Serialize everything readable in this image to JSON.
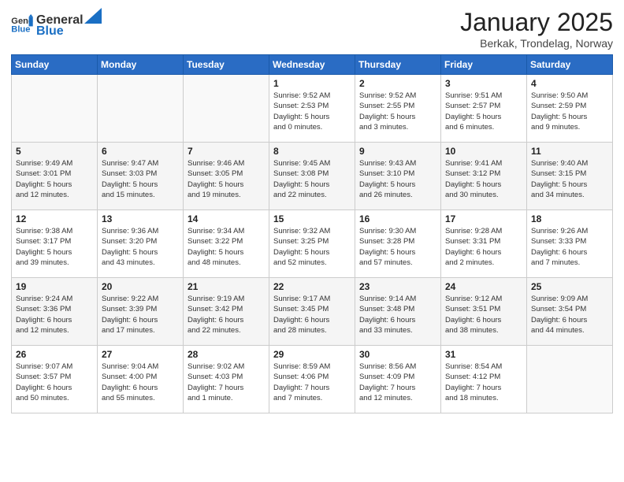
{
  "header": {
    "logo_general": "General",
    "logo_blue": "Blue",
    "title": "January 2025",
    "subtitle": "Berkak, Trondelag, Norway"
  },
  "weekdays": [
    "Sunday",
    "Monday",
    "Tuesday",
    "Wednesday",
    "Thursday",
    "Friday",
    "Saturday"
  ],
  "weeks": [
    [
      {
        "day": "",
        "info": ""
      },
      {
        "day": "",
        "info": ""
      },
      {
        "day": "",
        "info": ""
      },
      {
        "day": "1",
        "info": "Sunrise: 9:52 AM\nSunset: 2:53 PM\nDaylight: 5 hours\nand 0 minutes."
      },
      {
        "day": "2",
        "info": "Sunrise: 9:52 AM\nSunset: 2:55 PM\nDaylight: 5 hours\nand 3 minutes."
      },
      {
        "day": "3",
        "info": "Sunrise: 9:51 AM\nSunset: 2:57 PM\nDaylight: 5 hours\nand 6 minutes."
      },
      {
        "day": "4",
        "info": "Sunrise: 9:50 AM\nSunset: 2:59 PM\nDaylight: 5 hours\nand 9 minutes."
      }
    ],
    [
      {
        "day": "5",
        "info": "Sunrise: 9:49 AM\nSunset: 3:01 PM\nDaylight: 5 hours\nand 12 minutes."
      },
      {
        "day": "6",
        "info": "Sunrise: 9:47 AM\nSunset: 3:03 PM\nDaylight: 5 hours\nand 15 minutes."
      },
      {
        "day": "7",
        "info": "Sunrise: 9:46 AM\nSunset: 3:05 PM\nDaylight: 5 hours\nand 19 minutes."
      },
      {
        "day": "8",
        "info": "Sunrise: 9:45 AM\nSunset: 3:08 PM\nDaylight: 5 hours\nand 22 minutes."
      },
      {
        "day": "9",
        "info": "Sunrise: 9:43 AM\nSunset: 3:10 PM\nDaylight: 5 hours\nand 26 minutes."
      },
      {
        "day": "10",
        "info": "Sunrise: 9:41 AM\nSunset: 3:12 PM\nDaylight: 5 hours\nand 30 minutes."
      },
      {
        "day": "11",
        "info": "Sunrise: 9:40 AM\nSunset: 3:15 PM\nDaylight: 5 hours\nand 34 minutes."
      }
    ],
    [
      {
        "day": "12",
        "info": "Sunrise: 9:38 AM\nSunset: 3:17 PM\nDaylight: 5 hours\nand 39 minutes."
      },
      {
        "day": "13",
        "info": "Sunrise: 9:36 AM\nSunset: 3:20 PM\nDaylight: 5 hours\nand 43 minutes."
      },
      {
        "day": "14",
        "info": "Sunrise: 9:34 AM\nSunset: 3:22 PM\nDaylight: 5 hours\nand 48 minutes."
      },
      {
        "day": "15",
        "info": "Sunrise: 9:32 AM\nSunset: 3:25 PM\nDaylight: 5 hours\nand 52 minutes."
      },
      {
        "day": "16",
        "info": "Sunrise: 9:30 AM\nSunset: 3:28 PM\nDaylight: 5 hours\nand 57 minutes."
      },
      {
        "day": "17",
        "info": "Sunrise: 9:28 AM\nSunset: 3:31 PM\nDaylight: 6 hours\nand 2 minutes."
      },
      {
        "day": "18",
        "info": "Sunrise: 9:26 AM\nSunset: 3:33 PM\nDaylight: 6 hours\nand 7 minutes."
      }
    ],
    [
      {
        "day": "19",
        "info": "Sunrise: 9:24 AM\nSunset: 3:36 PM\nDaylight: 6 hours\nand 12 minutes."
      },
      {
        "day": "20",
        "info": "Sunrise: 9:22 AM\nSunset: 3:39 PM\nDaylight: 6 hours\nand 17 minutes."
      },
      {
        "day": "21",
        "info": "Sunrise: 9:19 AM\nSunset: 3:42 PM\nDaylight: 6 hours\nand 22 minutes."
      },
      {
        "day": "22",
        "info": "Sunrise: 9:17 AM\nSunset: 3:45 PM\nDaylight: 6 hours\nand 28 minutes."
      },
      {
        "day": "23",
        "info": "Sunrise: 9:14 AM\nSunset: 3:48 PM\nDaylight: 6 hours\nand 33 minutes."
      },
      {
        "day": "24",
        "info": "Sunrise: 9:12 AM\nSunset: 3:51 PM\nDaylight: 6 hours\nand 38 minutes."
      },
      {
        "day": "25",
        "info": "Sunrise: 9:09 AM\nSunset: 3:54 PM\nDaylight: 6 hours\nand 44 minutes."
      }
    ],
    [
      {
        "day": "26",
        "info": "Sunrise: 9:07 AM\nSunset: 3:57 PM\nDaylight: 6 hours\nand 50 minutes."
      },
      {
        "day": "27",
        "info": "Sunrise: 9:04 AM\nSunset: 4:00 PM\nDaylight: 6 hours\nand 55 minutes."
      },
      {
        "day": "28",
        "info": "Sunrise: 9:02 AM\nSunset: 4:03 PM\nDaylight: 7 hours\nand 1 minute."
      },
      {
        "day": "29",
        "info": "Sunrise: 8:59 AM\nSunset: 4:06 PM\nDaylight: 7 hours\nand 7 minutes."
      },
      {
        "day": "30",
        "info": "Sunrise: 8:56 AM\nSunset: 4:09 PM\nDaylight: 7 hours\nand 12 minutes."
      },
      {
        "day": "31",
        "info": "Sunrise: 8:54 AM\nSunset: 4:12 PM\nDaylight: 7 hours\nand 18 minutes."
      },
      {
        "day": "",
        "info": ""
      }
    ]
  ]
}
